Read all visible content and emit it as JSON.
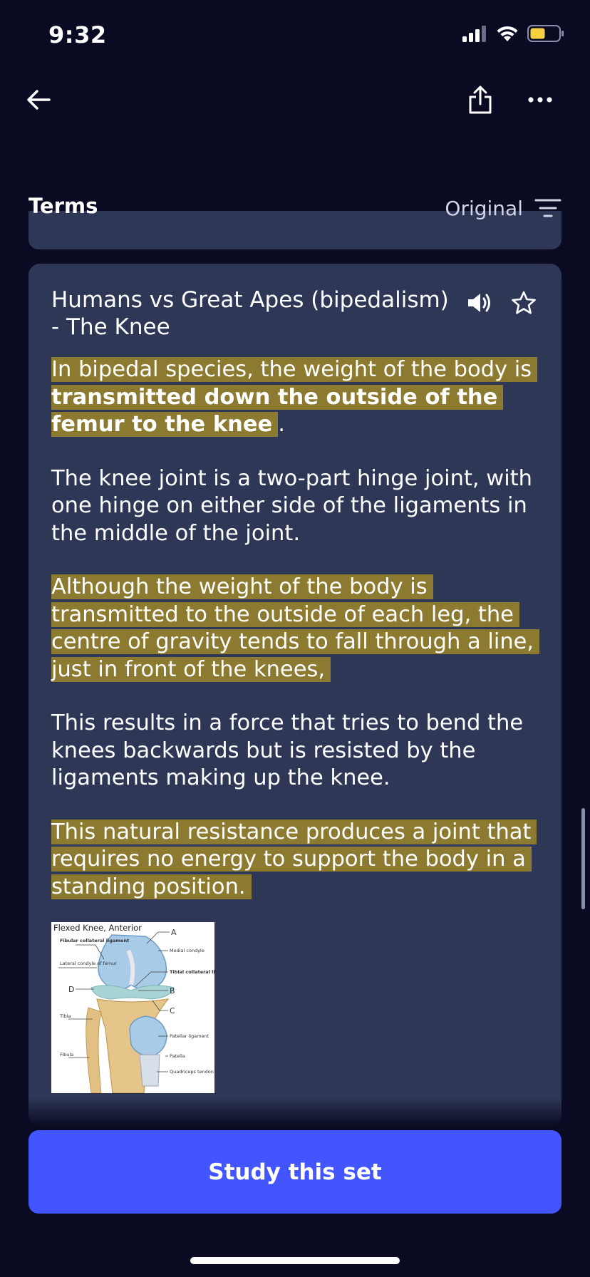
{
  "status_bar": {
    "time": "9:32",
    "battery_color": "#f5d040"
  },
  "nav": {
    "back_icon": "arrow-left-icon",
    "share_icon": "share-icon",
    "more_icon": "ellipsis-icon"
  },
  "terms_section": {
    "title": "Terms",
    "sort_label": "Original",
    "sort_icon": "filter-lines-icon"
  },
  "card": {
    "term": "Humans vs Great Apes (bipedalism) - The Knee",
    "audio_icon": "speaker-icon",
    "star_icon": "star-icon",
    "highlight_color": "#8b7a2f",
    "definition": {
      "p1_plain": "In bipedal species, the weight of the body is ",
      "p1_bold": "transmitted down the outside of the femur to the knee",
      "p1_end": ".",
      "p2": "The knee joint is a two-part hinge joint, with one hinge on either side of the ligaments in the middle of the joint.",
      "p3": "Although the weight of the body is transmitted to the outside of each leg, the centre of gravity tends to fall through a line, just in front of the knees,",
      "p4": "This results in a force that tries to bend the knees backwards but is resisted by the ligaments making up the knee.",
      "p5": "This natural resistance produces a joint that requires no energy to support the body in a standing position."
    },
    "image": {
      "title": "Flexed Knee, Anterior",
      "labels": {
        "fibular_collateral": "Fibular collateral ligament",
        "lateral_condyle": "Lateral condyle of femur",
        "tibia": "Tibia",
        "fibula": "Fibula",
        "medial_condyle": "Medial condyle",
        "tibial_collateral": "Tibial collateral ligament",
        "patellar_ligament": "Patellar ligament",
        "patella": "Patella",
        "quadriceps_tendon": "Quadriceps tendon",
        "a": "A",
        "b": "B",
        "c": "C",
        "d": "D"
      }
    }
  },
  "study_button": {
    "label": "Study this set",
    "color": "#4255ff"
  }
}
